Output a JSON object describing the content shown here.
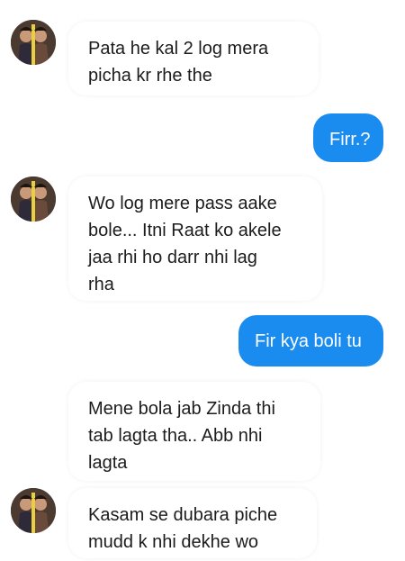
{
  "conversation": {
    "messages": [
      {
        "from": "them",
        "lines": [
          "Pata he kal 2 log mera",
          "picha kr rhe the"
        ]
      },
      {
        "from": "me",
        "text": "Firr.?"
      },
      {
        "from": "them",
        "lines": [
          "Wo log mere pass aake",
          "bole... Itni Raat ko akele",
          "jaa rhi ho darr nhi lag",
          "rha"
        ]
      },
      {
        "from": "me",
        "text": "Fir kya boli tu"
      },
      {
        "from": "them",
        "lines": [
          "Mene bola jab Zinda thi",
          "tab lagta tha.. Abb nhi",
          "lagta"
        ]
      },
      {
        "from": "them",
        "lines": [
          "Kasam se dubara piche",
          "mudd k nhi dekhe wo"
        ]
      }
    ]
  },
  "colors": {
    "outgoing_bubble": "#1a8cf0",
    "incoming_bubble": "#ffffff",
    "text_dark": "#1c1c1c"
  },
  "icons": {
    "avatar": "profile-photo-icon"
  }
}
